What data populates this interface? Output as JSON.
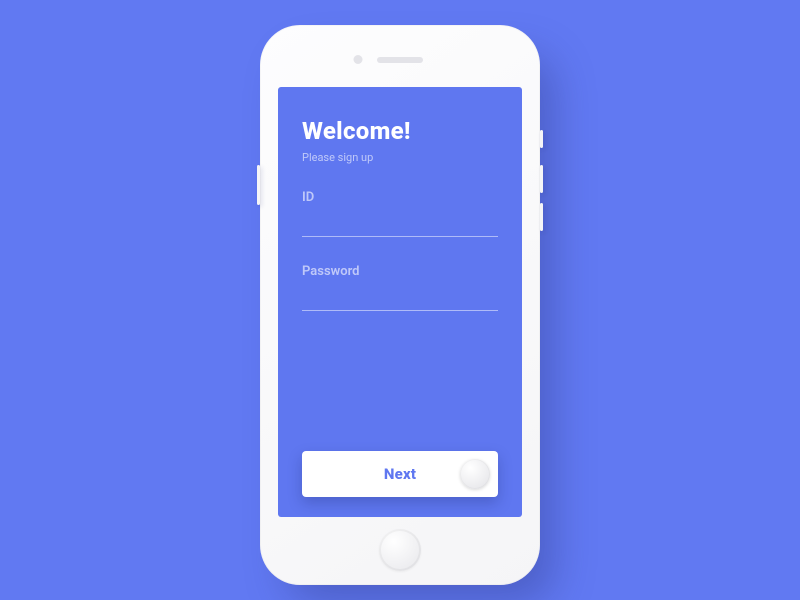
{
  "colors": {
    "background": "#6179F2",
    "screen": "#5F77F0",
    "device": "#F5F5F7",
    "button_text": "#5F77F0"
  },
  "signup": {
    "title": "Welcome!",
    "subtitle": "Please sign up",
    "fields": {
      "id": {
        "label": "ID",
        "value": "",
        "placeholder": ""
      },
      "password": {
        "label": "Password",
        "value": "",
        "placeholder": ""
      }
    },
    "next_label": "Next"
  }
}
